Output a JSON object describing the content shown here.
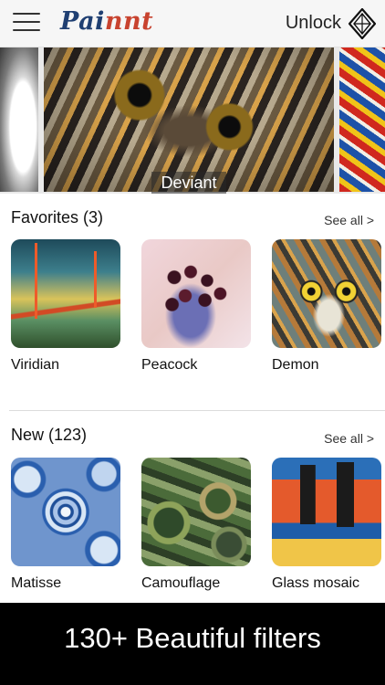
{
  "header": {
    "logo": {
      "part1": "Pai",
      "part2": "nnt"
    },
    "unlock_label": "Unlock"
  },
  "carousel": {
    "current_caption": "Deviant"
  },
  "favorites": {
    "title": "Favorites (3)",
    "see_all": "See all >",
    "items": [
      {
        "label": "Viridian"
      },
      {
        "label": "Peacock"
      },
      {
        "label": "Demon"
      }
    ]
  },
  "new": {
    "title": "New (123)",
    "see_all": "See all >",
    "items": [
      {
        "label": "Matisse"
      },
      {
        "label": "Camouflage"
      },
      {
        "label": "Glass mosaic"
      }
    ]
  },
  "banner": {
    "text": "130+ Beautiful filters"
  },
  "icons": {
    "menu": "hamburger-menu-icon",
    "unlock": "diamond-icon"
  }
}
